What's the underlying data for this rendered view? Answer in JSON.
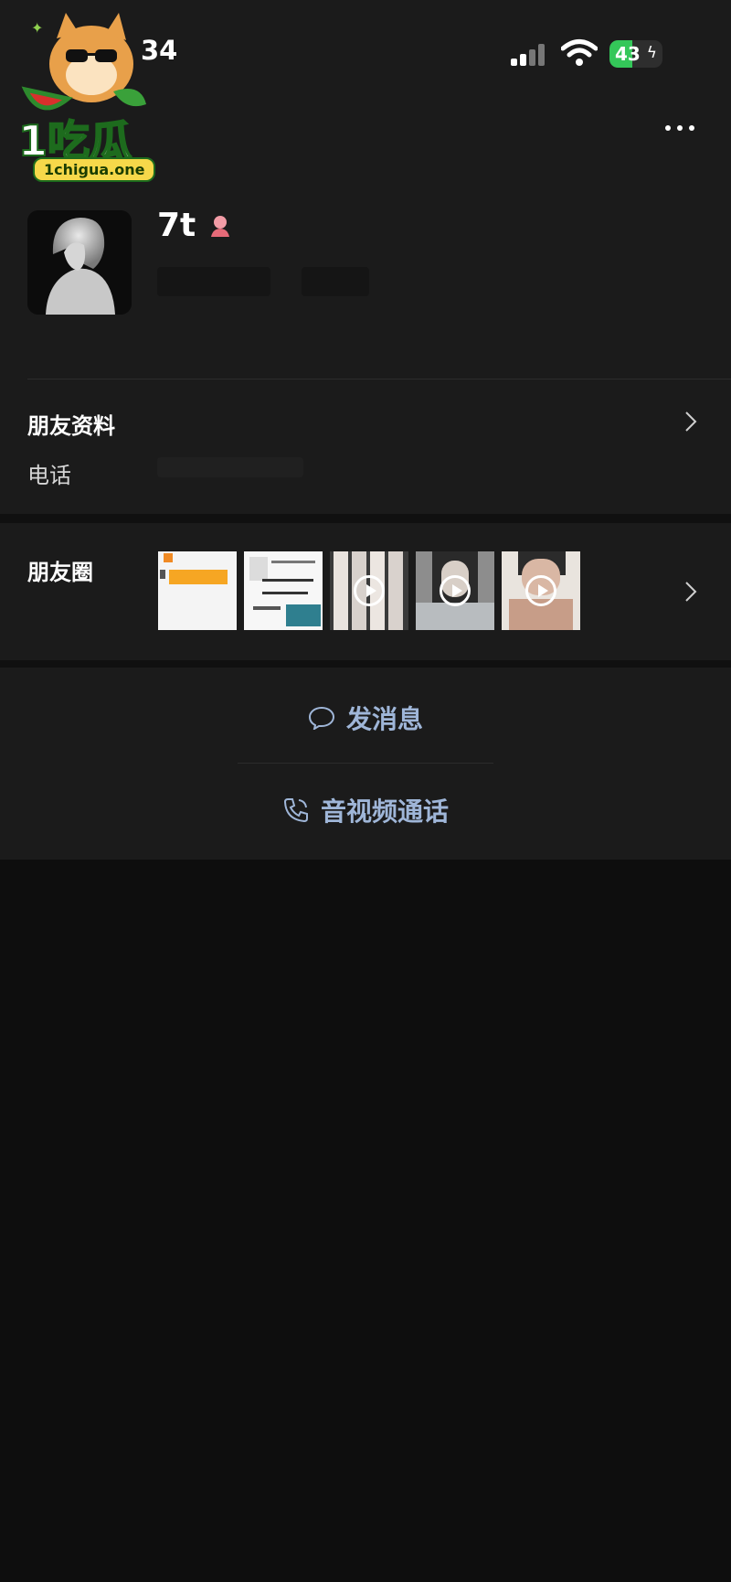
{
  "status_bar": {
    "time": "34",
    "battery": "43",
    "battery_level": 0.43
  },
  "watermark": {
    "brand": "1吃瓜",
    "domain": "1chigua.one"
  },
  "profile": {
    "nickname": "7t"
  },
  "profile_info": {
    "title": "朋友资料",
    "phone_label": "电话"
  },
  "moments": {
    "title": "朋友圈"
  },
  "actions": {
    "message": "发消息",
    "call": "音视频通话"
  },
  "colors": {
    "background_top": "#1b1b1b",
    "background_bottom": "#0e0e0e",
    "action_text": "#9fb6d8",
    "battery_green": "#34c759"
  },
  "icons": [
    "signal-icon",
    "wifi-icon",
    "battery-icon",
    "more-icon",
    "female-icon",
    "chevron-right-icon",
    "chat-bubble-icon",
    "phone-icon",
    "play-icon"
  ]
}
